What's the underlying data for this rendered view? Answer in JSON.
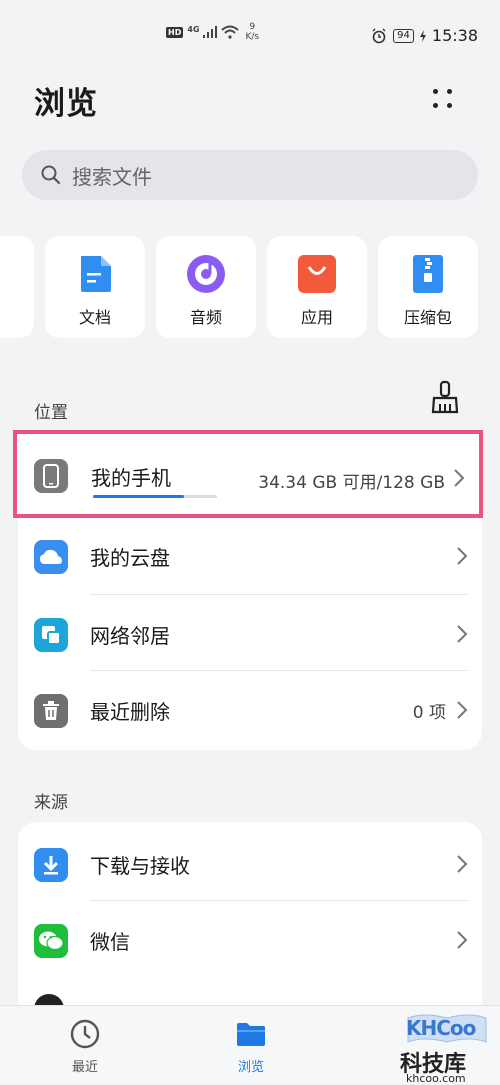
{
  "status_bar": {
    "hd": "HD",
    "network": "4G",
    "speed_value": "9",
    "speed_unit": "K/s",
    "battery": "94",
    "time": "15:38"
  },
  "header": {
    "title": "浏览"
  },
  "search": {
    "placeholder": "搜索文件"
  },
  "categories": [
    {
      "label": "文档",
      "icon": "document-icon",
      "color": "#2f8ef0"
    },
    {
      "label": "音频",
      "icon": "audio-icon",
      "color": "#8a5cf0"
    },
    {
      "label": "应用",
      "icon": "app-icon",
      "color": "#f25a3b"
    },
    {
      "label": "压缩包",
      "icon": "archive-icon",
      "color": "#2f8ef0"
    }
  ],
  "locations": {
    "label": "位置",
    "items": [
      {
        "label": "我的手机",
        "value": "34.34 GB 可用/128 GB",
        "icon": "phone-icon",
        "storage_used_fraction": 0.73
      },
      {
        "label": "我的云盘",
        "value": "",
        "icon": "cloud-icon"
      },
      {
        "label": "网络邻居",
        "value": "",
        "icon": "network-icon"
      },
      {
        "label": "最近删除",
        "value": "0 项",
        "icon": "trash-icon"
      }
    ]
  },
  "sources": {
    "label": "来源",
    "items": [
      {
        "label": "下载与接收",
        "icon": "download-icon"
      },
      {
        "label": "微信",
        "icon": "wechat-icon"
      }
    ]
  },
  "tabs": [
    {
      "label": "最近",
      "icon": "clock-icon",
      "active": false
    },
    {
      "label": "浏览",
      "icon": "folder-icon",
      "active": true
    }
  ],
  "watermark": {
    "logo": "KHCoo",
    "name": "科技库",
    "url": "khcoo.com"
  },
  "colors": {
    "accent": "#1e78e6",
    "highlight": "#e8547d"
  }
}
